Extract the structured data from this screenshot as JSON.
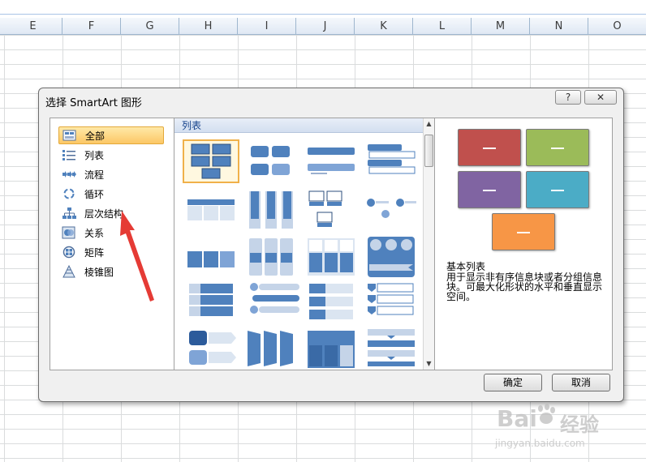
{
  "sheet": {
    "columns": [
      "E",
      "F",
      "G",
      "H",
      "I",
      "J",
      "K",
      "L",
      "M",
      "N",
      "O"
    ]
  },
  "dialog": {
    "title": "选择 SmartArt 图形",
    "help_label": "?",
    "close_label": "✕",
    "categories": [
      {
        "label": "全部",
        "icon": "all-icon",
        "selected": true
      },
      {
        "label": "列表",
        "icon": "list-icon"
      },
      {
        "label": "流程",
        "icon": "process-icon"
      },
      {
        "label": "循环",
        "icon": "cycle-icon"
      },
      {
        "label": "层次结构",
        "icon": "hierarchy-icon"
      },
      {
        "label": "关系",
        "icon": "relationship-icon"
      },
      {
        "label": "矩阵",
        "icon": "matrix-icon"
      },
      {
        "label": "棱锥图",
        "icon": "pyramid-icon"
      }
    ],
    "gallery_header": "列表",
    "preview_title": "基本列表",
    "preview_desc": "用于显示非有序信息块或者分组信息块。可最大化形状的水平和垂直显示空间。",
    "ok_label": "确定",
    "cancel_label": "取消",
    "preview_colors": [
      "#c0504d",
      "#9bbb59",
      "#8064a2",
      "#4bacc6",
      "#f79646"
    ],
    "accent": "#4f81bd"
  },
  "watermark": {
    "brand": "Bai",
    "brand2": "经验",
    "url": "jingyan.baidu.com"
  }
}
